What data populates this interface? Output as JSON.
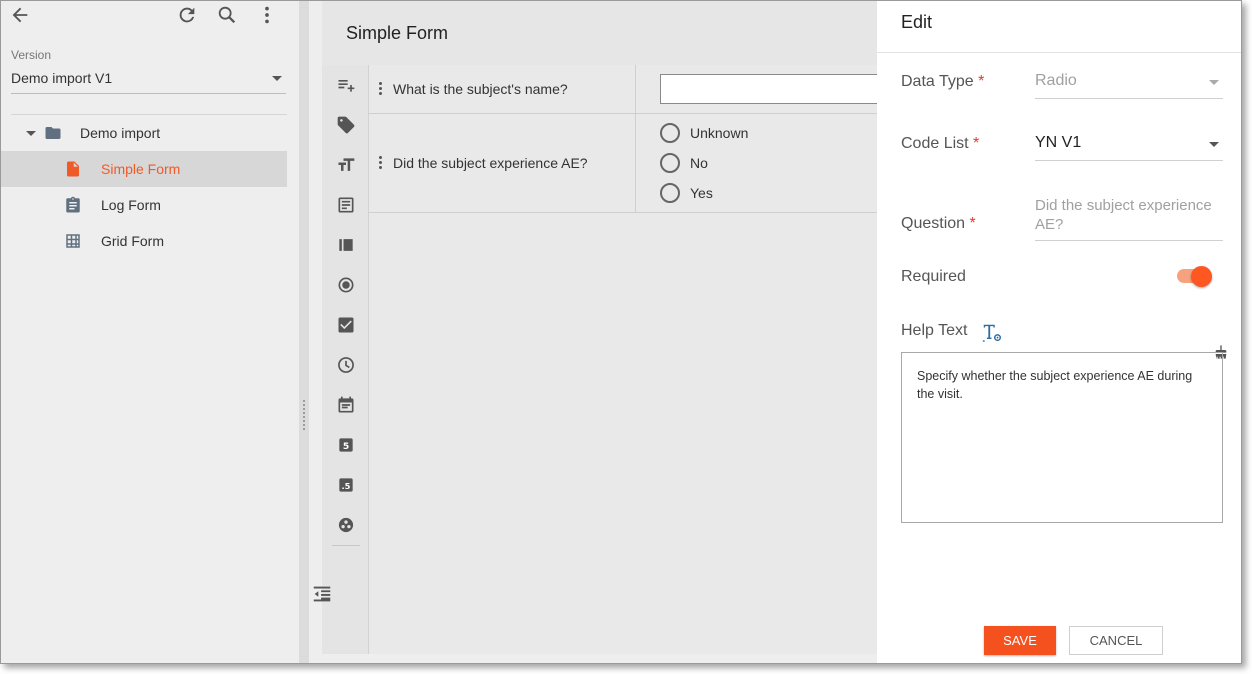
{
  "sidebar": {
    "version_label": "Version",
    "version_value": "Demo import V1",
    "tree": {
      "folder": "Demo import",
      "items": [
        {
          "label": "Simple Form",
          "icon": "document-icon",
          "selected": true
        },
        {
          "label": "Log Form",
          "icon": "clipboard-icon"
        },
        {
          "label": "Grid Form",
          "icon": "grid-icon"
        }
      ]
    }
  },
  "form": {
    "title": "Simple Form",
    "questions": [
      {
        "text": "What is the subject's name?",
        "type": "text"
      },
      {
        "text": "Did the subject experience AE?",
        "type": "radio",
        "options": [
          "Unknown",
          "No",
          "Yes"
        ]
      }
    ]
  },
  "edit": {
    "title": "Edit",
    "data_type_label": "Data Type",
    "data_type_value": "Radio",
    "code_list_label": "Code List",
    "code_list_value": "YN V1",
    "question_label": "Question",
    "question_value": "Did the subject experience AE?",
    "required_label": "Required",
    "required_on": true,
    "help_label": "Help Text",
    "help_text": "Specify whether the subject experience AE during the visit.",
    "save_label": "SAVE",
    "cancel_label": "CANCEL",
    "required_marker": "*"
  },
  "colors": {
    "accent": "#f4511e",
    "selected_bg": "#d7d7d7",
    "required": "#e03a2e"
  }
}
